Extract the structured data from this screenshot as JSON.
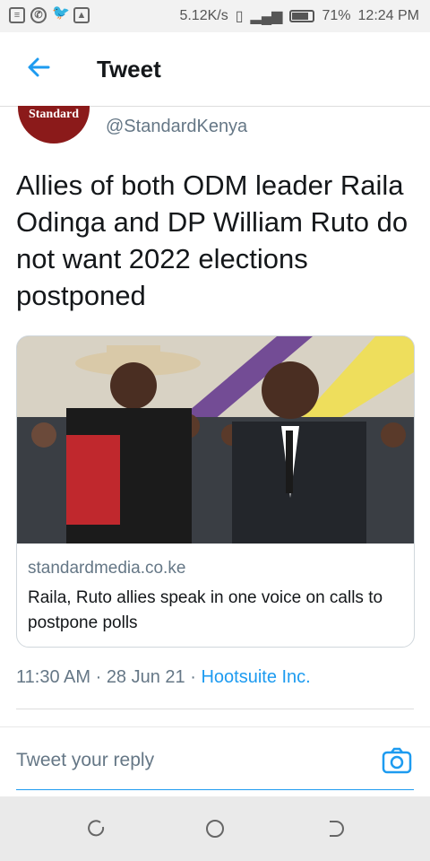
{
  "status_bar": {
    "speed": "5.12K/s",
    "battery": "71%",
    "time": "12:24 PM"
  },
  "header": {
    "title": "Tweet"
  },
  "tweet": {
    "avatar_text": "Standard",
    "handle": "@StandardKenya",
    "text": "Allies of both ODM leader Raila Odinga and DP William Ruto do not want 2022 elections postponed",
    "card": {
      "domain": "standardmedia.co.ke",
      "title": "Raila, Ruto allies speak in one voice on calls to postpone polls"
    },
    "time": "11:30 AM",
    "date": "28 Jun 21",
    "source": "Hootsuite Inc."
  },
  "reply": {
    "placeholder": "Tweet your reply"
  },
  "colors": {
    "accent": "#1d9bf0",
    "avatar_bg": "#8b1a1a"
  },
  "icons": [
    "back-arrow-icon",
    "camera-icon",
    "recent-apps-icon",
    "home-icon",
    "back-nav-icon"
  ]
}
